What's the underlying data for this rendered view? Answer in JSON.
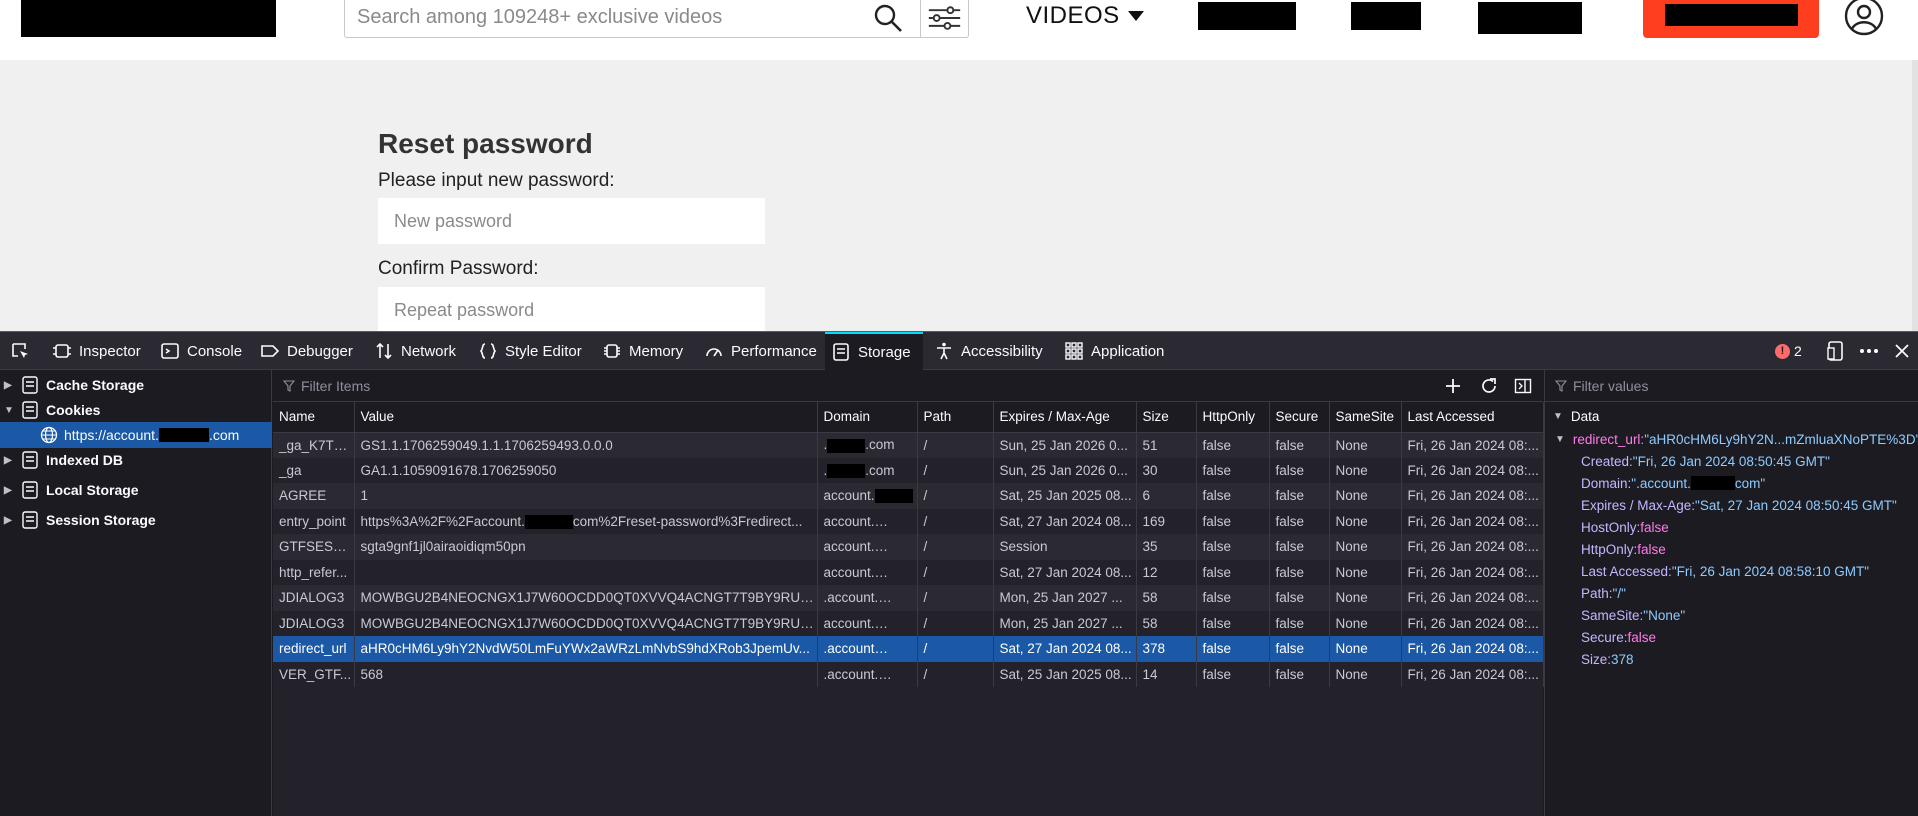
{
  "site": {
    "search_placeholder": "Search among 109248+ exclusive videos",
    "videos_label": "VIDEOS"
  },
  "reset": {
    "title": "Reset password",
    "new_label": "Please input new password:",
    "new_placeholder": "New password",
    "confirm_label": "Confirm Password:",
    "confirm_placeholder": "Repeat password"
  },
  "devtools": {
    "tabs": [
      "Inspector",
      "Console",
      "Debugger",
      "Network",
      "Style Editor",
      "Memory",
      "Performance",
      "Storage",
      "Accessibility",
      "Application"
    ],
    "active_tab": "Storage",
    "error_count": "2",
    "tree": {
      "cache_storage": "Cache Storage",
      "cookies": "Cookies",
      "cookie_host_prefix": "https://account.",
      "cookie_host_suffix": ".com",
      "indexed_db": "Indexed DB",
      "local_storage": "Local Storage",
      "session_storage": "Session Storage"
    },
    "filter_items_placeholder": "Filter Items",
    "filter_values_placeholder": "Filter values",
    "columns": [
      "Name",
      "Value",
      "Domain",
      "Path",
      "Expires / Max-Age",
      "Size",
      "HttpOnly",
      "Secure",
      "SameSite",
      "Last Accessed"
    ],
    "rows": [
      {
        "name": "_ga_K7TR...",
        "value": "GS1.1.1706259049.1.1.1706259493.0.0.0",
        "domain_pre": ".",
        "domain_post": ".com",
        "path": "/",
        "expires": "Sun, 25 Jan 2026 0...",
        "size": "51",
        "httponly": "false",
        "secure": "false",
        "samesite": "None",
        "last": "Fri, 26 Jan 2024 08:..."
      },
      {
        "name": "_ga",
        "value": "GA1.1.1059091678.1706259050",
        "domain_pre": ".",
        "domain_post": ".com",
        "path": "/",
        "expires": "Sun, 25 Jan 2026 0...",
        "size": "30",
        "httponly": "false",
        "secure": "false",
        "samesite": "None",
        "last": "Fri, 26 Jan 2024 08:..."
      },
      {
        "name": "AGREE",
        "value": "1",
        "domain_pre": "account.",
        "domain_post": "",
        "path": "/",
        "expires": "Sat, 25 Jan 2025 08...",
        "size": "6",
        "httponly": "false",
        "secure": "false",
        "samesite": "None",
        "last": "Fri, 26 Jan 2024 08:..."
      },
      {
        "name": "entry_point",
        "value": "https%3A%2F%2Faccount.",
        "value_post": "com%2Freset-password%3Fredirect...",
        "domain_pre": "account.",
        "domain_post": "...",
        "path": "/",
        "expires": "Sat, 27 Jan 2024 08...",
        "size": "169",
        "httponly": "false",
        "secure": "false",
        "samesite": "None",
        "last": "Fri, 26 Jan 2024 08:..."
      },
      {
        "name": "GTFSESSID",
        "value": "sgta9gnf1jl0airaoidiqm50pn",
        "domain_pre": "account.",
        "domain_post": "...",
        "path": "/",
        "expires": "Session",
        "size": "35",
        "httponly": "false",
        "secure": "false",
        "samesite": "None",
        "last": "Fri, 26 Jan 2024 08:..."
      },
      {
        "name": "http_refer...",
        "value": "",
        "domain_pre": "account.",
        "domain_post": "l...",
        "path": "/",
        "expires": "Sat, 27 Jan 2024 08...",
        "size": "12",
        "httponly": "false",
        "secure": "false",
        "samesite": "None",
        "last": "Fri, 26 Jan 2024 08:..."
      },
      {
        "name": "JDIALOG3",
        "value": "MOWBGU2B4NEOCNGX1J7W60OCDD0QT0XVVQ4ACNGT7T9BY9RUUY",
        "domain_pre": ".account.",
        "domain_post": "...",
        "path": "/",
        "expires": "Mon, 25 Jan 2027 ...",
        "size": "58",
        "httponly": "false",
        "secure": "false",
        "samesite": "None",
        "last": "Fri, 26 Jan 2024 08:..."
      },
      {
        "name": "JDIALOG3",
        "value": "MOWBGU2B4NEOCNGX1J7W60OCDD0QT0XVVQ4ACNGT7T9BY9RUUY",
        "domain_pre": "account.",
        "domain_post": "...",
        "path": "/",
        "expires": "Mon, 25 Jan 2027 ...",
        "size": "58",
        "httponly": "false",
        "secure": "false",
        "samesite": "None",
        "last": "Fri, 26 Jan 2024 08:..."
      },
      {
        "name": "redirect_url",
        "value": "aHR0cHM6Ly9hY2NvdW50LmFuYWx2aWRzLmNvbS9hdXRob3JpemUv...",
        "domain_pre": ".account",
        "domain_post": "...",
        "path": "/",
        "expires": "Sat, 27 Jan 2024 08...",
        "size": "378",
        "httponly": "false",
        "secure": "false",
        "samesite": "None",
        "last": "Fri, 26 Jan 2024 08:...",
        "selected": true
      },
      {
        "name": "VER_GTF...",
        "value": "568",
        "domain_pre": ".account.",
        "domain_post": "...",
        "path": "/",
        "expires": "Sat, 25 Jan 2025 08...",
        "size": "14",
        "httponly": "false",
        "secure": "false",
        "samesite": "None",
        "last": "Fri, 26 Jan 2024 08:..."
      }
    ],
    "sidebar": {
      "section": "Data",
      "root_key": "redirect_url:",
      "root_value": "\"aHR0cHM6Ly9hY2N...mZmluaXNoPTE%3D\"",
      "created_key": "Created:",
      "created_value": "\"Fri, 26 Jan 2024 08:50:45 GMT\"",
      "domain_key": "Domain:",
      "domain_value_pre": "\".account.",
      "domain_value_post": "com\"",
      "expires_key": "Expires / Max-Age:",
      "expires_value": "\"Sat, 27 Jan 2024 08:50:45 GMT\"",
      "hostonly_key": "HostOnly:",
      "hostonly_value": "false",
      "httponly_key": "HttpOnly:",
      "httponly_value": "false",
      "lastaccessed_key": "Last Accessed:",
      "lastaccessed_value": "\"Fri, 26 Jan 2024 08:58:10 GMT\"",
      "path_key": "Path:",
      "path_value": "\"/\"",
      "samesite_key": "SameSite:",
      "samesite_value": "\"None\"",
      "secure_key": "Secure:",
      "secure_value": "false",
      "size_key": "Size:",
      "size_value": "378"
    }
  }
}
